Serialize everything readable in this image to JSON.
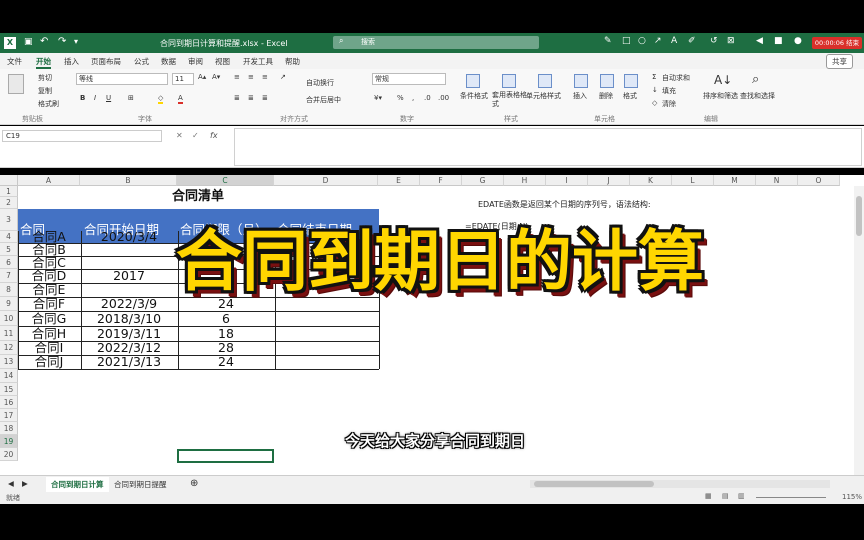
{
  "window": {
    "title": "合同到期日计算和提醒.xlsx - Excel",
    "search_placeholder": "搜索",
    "recording_time": "00:00:06 结束"
  },
  "ribbon_tabs": [
    "文件",
    "开始",
    "插入",
    "页面布局",
    "公式",
    "数据",
    "审阅",
    "视图",
    "开发工具",
    "帮助"
  ],
  "share_label": "共享",
  "ribbon": {
    "clipboard": {
      "cut": "剪切",
      "copy": "复制",
      "format_painter": "格式刷",
      "group": "剪贴板"
    },
    "font": {
      "name": "等线",
      "size": "11",
      "group": "字体"
    },
    "alignment": {
      "wrap": "自动换行",
      "merge": "合并后居中",
      "group": "对齐方式"
    },
    "number": {
      "format": "常规",
      "group": "数字"
    },
    "styles": {
      "conditional": "条件格式",
      "table": "套用表格格式",
      "cell_styles": "单元格样式",
      "group": "样式"
    },
    "cells": {
      "insert": "插入",
      "delete": "删除",
      "format": "格式",
      "group": "单元格"
    },
    "editing": {
      "autosum": "自动求和",
      "fill": "填充",
      "clear": "清除",
      "sort": "排序和筛选",
      "find": "查找和选择",
      "group": "编辑"
    }
  },
  "formula_bar": {
    "name_box": "C19",
    "fx": "fx",
    "value": ""
  },
  "columns": [
    "A",
    "B",
    "C",
    "D",
    "E",
    "F",
    "G",
    "H",
    "I",
    "J",
    "K",
    "L",
    "M",
    "N",
    "O"
  ],
  "rows": [
    "1",
    "2",
    "3",
    "4",
    "5",
    "6",
    "7",
    "8",
    "9",
    "10",
    "11",
    "12",
    "13",
    "14",
    "15",
    "16",
    "17",
    "18",
    "19",
    "20"
  ],
  "sheet": {
    "table_title": "合同清单",
    "headers": [
      "合同",
      "合同开始日期",
      "合同期限（月）",
      "合同结束日期"
    ],
    "data": [
      [
        "合同A",
        "2020/3/4",
        ""
      ],
      [
        "合同B",
        "",
        ""
      ],
      [
        "合同C",
        "",
        ""
      ],
      [
        "合同D",
        "2017",
        ""
      ],
      [
        "合同E",
        "",
        ""
      ],
      [
        "合同F",
        "2022/3/9",
        "24"
      ],
      [
        "合同G",
        "2018/3/10",
        "6"
      ],
      [
        "合同H",
        "2019/3/11",
        "18"
      ],
      [
        "合同I",
        "2022/3/12",
        "28"
      ],
      [
        "合同J",
        "2021/3/13",
        "24"
      ]
    ],
    "note_line1": "EDATE函数是返回某个日期的序列号，语法结构:",
    "note_line2": "=EDATE(日期,N)"
  },
  "sheet_tabs": [
    "合同到期日计算",
    "合同到期日提醒"
  ],
  "status": {
    "left": "就绪",
    "zoom": "115%"
  },
  "overlay_title": "合同到期日的计算",
  "subtitle": "今天给大家分享合同到期日",
  "colors": {
    "excel_green": "#1e6e42",
    "header_blue": "#4472c4",
    "overlay_yellow": "#ffd600",
    "recording_red": "#d9302a"
  }
}
